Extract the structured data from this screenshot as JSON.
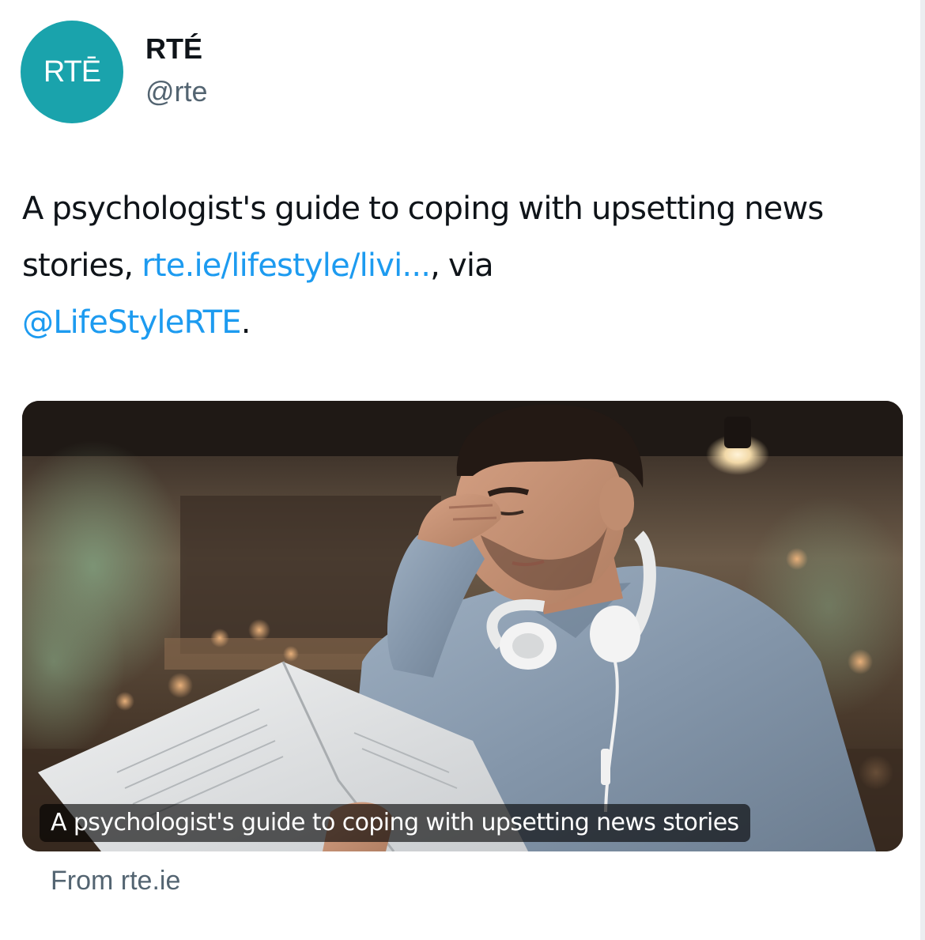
{
  "author": {
    "avatar_text": "RTĒ",
    "display_name": "RTÉ",
    "handle": "@rte"
  },
  "tweet": {
    "text_part1": "A psychologist's guide to coping with upsetting news stories, ",
    "link_text": "rte.ie/lifestyle/livi...",
    "text_part2": ", via ",
    "mention_text": "@LifeStyleRTE",
    "text_part3": "."
  },
  "card": {
    "caption": "A psychologist's guide to coping with upsetting news stories",
    "source": "From rte.ie"
  },
  "colors": {
    "avatar_bg": "#1aa3ac",
    "link": "#1d9bf0",
    "secondary_text": "#536471"
  },
  "icons": {
    "avatar": "rte-logo-icon"
  }
}
